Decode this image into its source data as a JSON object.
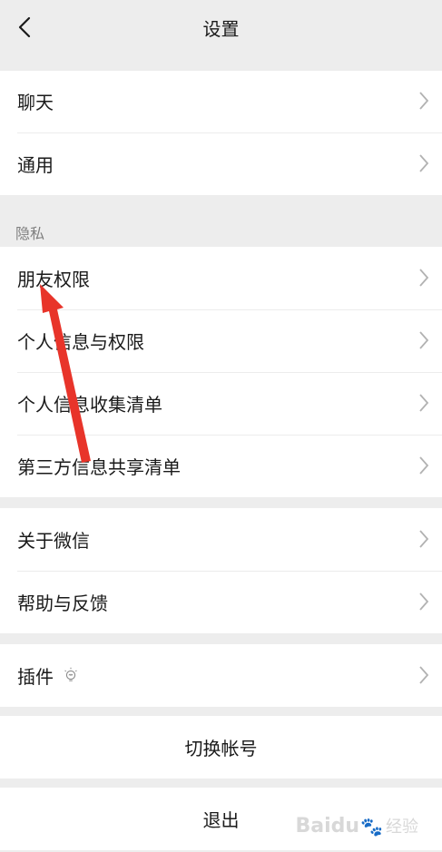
{
  "header": {
    "title": "设置"
  },
  "group_general": {
    "items": [
      {
        "label": "聊天"
      },
      {
        "label": "通用"
      }
    ]
  },
  "privacy": {
    "section_label": "隐私",
    "items": [
      {
        "label": "朋友权限"
      },
      {
        "label": "个人信息与权限"
      },
      {
        "label": "个人信息收集清单"
      },
      {
        "label": "第三方信息共享清单"
      }
    ]
  },
  "group_about": {
    "items": [
      {
        "label": "关于微信"
      },
      {
        "label": "帮助与反馈"
      }
    ]
  },
  "group_plugins": {
    "items": [
      {
        "label": "插件",
        "icon": "lightbulb-icon"
      }
    ]
  },
  "actions": {
    "switch_account": "切换帐号",
    "logout": "退出"
  },
  "annotation": {
    "arrow_color": "#e8342a",
    "points_to": "朋友权限"
  },
  "watermark": {
    "brand": "Baidu",
    "sub": "经验"
  },
  "colors": {
    "background": "#ededed",
    "card": "#ffffff",
    "text": "#1a1a1a",
    "secondary_text": "#7f7f7f",
    "chevron": "#b2b2b2"
  }
}
